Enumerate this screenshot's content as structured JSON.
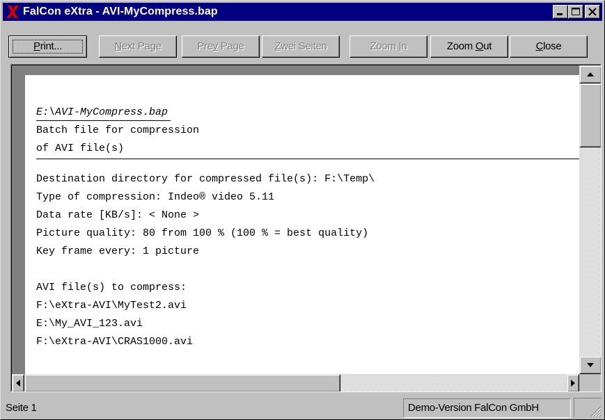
{
  "window": {
    "title": "FalCon eXtra - AVI-MyCompress.bap",
    "app_icon": "red-x-icon",
    "controls": [
      "minimize-icon",
      "maximize-icon",
      "close-icon"
    ]
  },
  "toolbar": {
    "print": {
      "pre": "",
      "u": "P",
      "post": "rint..."
    },
    "next_page": {
      "pre": "",
      "u": "N",
      "post": "ext Page"
    },
    "prev_page": {
      "pre": "Pre",
      "u": "v",
      "post": " Page"
    },
    "zwei_seiten": {
      "pre": "",
      "u": "Z",
      "post": "wei Seiten"
    },
    "zoom_in": {
      "pre": "Zoom ",
      "u": "I",
      "post": "n"
    },
    "zoom_out": {
      "pre": "Zoom ",
      "u": "O",
      "post": "ut"
    },
    "close": {
      "pre": "",
      "u": "C",
      "post": "lose"
    }
  },
  "document": {
    "filename": "E:\\AVI-MyCompress.bap",
    "header_lines": [
      "Batch file for compression",
      "of AVI file(s)"
    ],
    "settings": [
      "Destination directory for compressed file(s): F:\\Temp\\",
      "Type of compression: Indeo® video 5.11",
      "Data rate [KB/s]: < None >",
      "Picture quality: 80 from 100 % (100 % = best quality)",
      "Key frame every: 1 picture"
    ],
    "files_heading": "AVI file(s) to compress:",
    "files": [
      "F:\\eXtra-AVI\\MyTest2.avi",
      "E:\\My_AVI_123.avi",
      "F:\\eXtra-AVI\\CRAS1000.avi"
    ]
  },
  "status": {
    "page": "Seite 1",
    "info": "Demo-Version FalCon GmbH"
  }
}
